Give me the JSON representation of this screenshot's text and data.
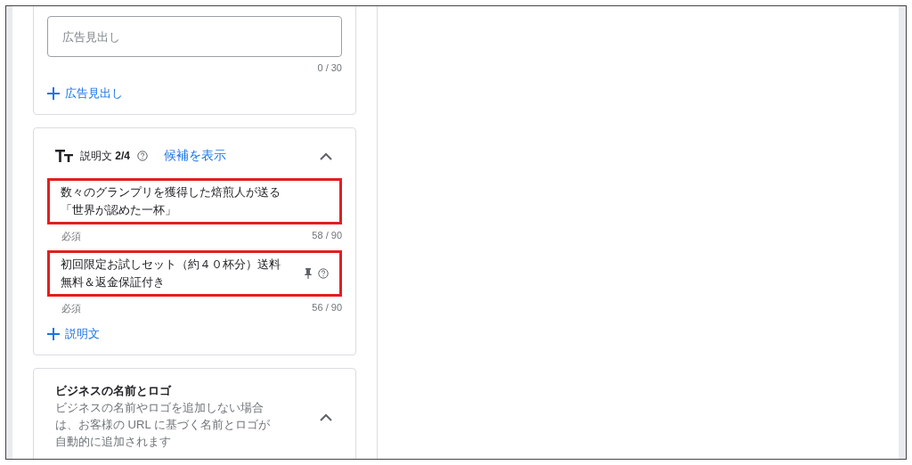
{
  "headline_card": {
    "field": {
      "placeholder": "広告見出し"
    },
    "counter": "0 / 30",
    "add_button": "広告見出し"
  },
  "description_card": {
    "title": "説明文 **2/4**",
    "suggest_link": "候補を表示",
    "expanded": true,
    "fields": [
      {
        "value": "数々のグランプリを獲得した焙煎人が送る「世界が認めた一杯」",
        "required": "必須",
        "counter": "58 / 90",
        "highlighted": true,
        "pinned": false
      },
      {
        "value": "初回限定お試しセット（約４０杯分）送料無料＆返金保証付き",
        "required": "必須",
        "counter": "56 / 90",
        "highlighted": true,
        "pinned": true
      }
    ],
    "add_button": "説明文"
  },
  "business_card": {
    "title": "ビジネスの名前とロゴ",
    "description": "ビジネスの名前やロゴを追加しない場合は、お客様の URL に基づく名前とロゴが自動的に追加されます",
    "expanded": true
  }
}
